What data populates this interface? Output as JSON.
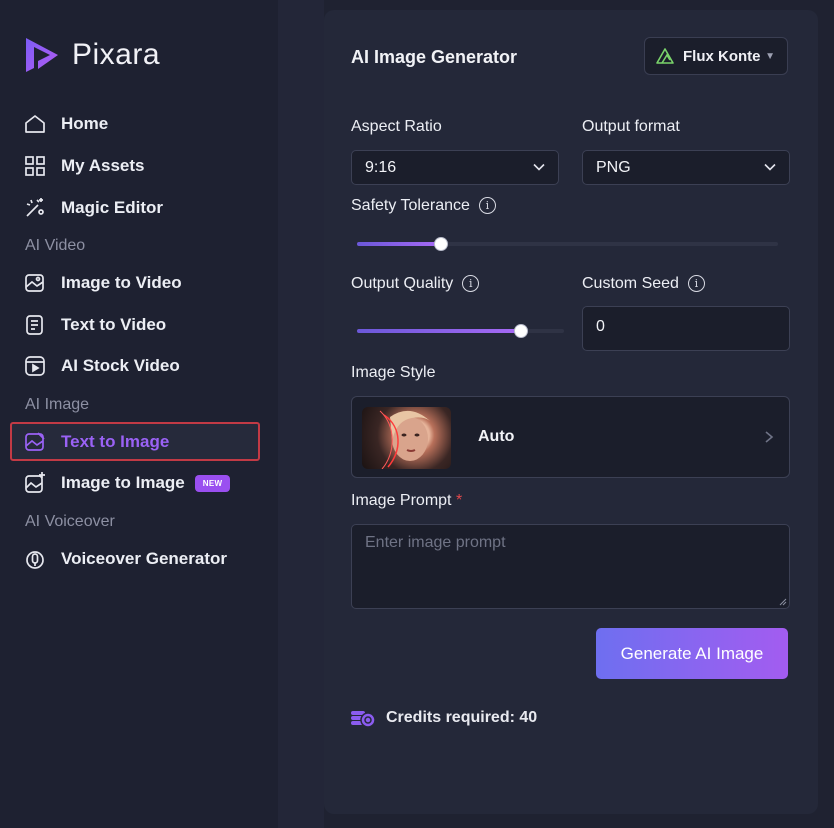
{
  "brand": {
    "name": "Pixara"
  },
  "sidebar": {
    "items": [
      {
        "label": "Home",
        "icon": "home-icon"
      },
      {
        "label": "My Assets",
        "icon": "grid-icon"
      },
      {
        "label": "Magic Editor",
        "icon": "magic-wand-icon"
      }
    ],
    "sections": [
      {
        "label": "AI Video",
        "items": [
          {
            "label": "Image to Video",
            "icon": "image-video-icon"
          },
          {
            "label": "Text to Video",
            "icon": "text-video-icon"
          },
          {
            "label": "AI Stock Video",
            "icon": "stock-video-icon"
          }
        ]
      },
      {
        "label": "AI Image",
        "items": [
          {
            "label": "Text to Image",
            "icon": "text-image-icon",
            "active": true
          },
          {
            "label": "Image to Image",
            "icon": "image-image-icon",
            "badge": "NEW"
          }
        ]
      },
      {
        "label": "AI Voiceover",
        "items": [
          {
            "label": "Voiceover Generator",
            "icon": "microphone-icon"
          }
        ]
      }
    ]
  },
  "panel": {
    "title": "AI Image Generator",
    "model": {
      "label": "Flux Konte",
      "icon": "flux-logo-icon"
    },
    "aspect_ratio": {
      "label": "Aspect Ratio",
      "value": "9:16"
    },
    "output_format": {
      "label": "Output format",
      "value": "PNG"
    },
    "safety_tolerance": {
      "label": "Safety Tolerance",
      "level": 0.2
    },
    "output_quality": {
      "label": "Output Quality",
      "level": 0.79
    },
    "custom_seed": {
      "label": "Custom Seed",
      "value": "0"
    },
    "image_style": {
      "label": "Image Style",
      "value": "Auto"
    },
    "image_prompt": {
      "label": "Image Prompt",
      "required_mark": "*",
      "placeholder": "Enter image prompt"
    },
    "generate_label": "Generate AI Image",
    "credits": "Credits required: 40"
  },
  "colors": {
    "accent": "#9a62f5",
    "highlight_border": "#c23a45",
    "panel_bg": "#242839"
  }
}
